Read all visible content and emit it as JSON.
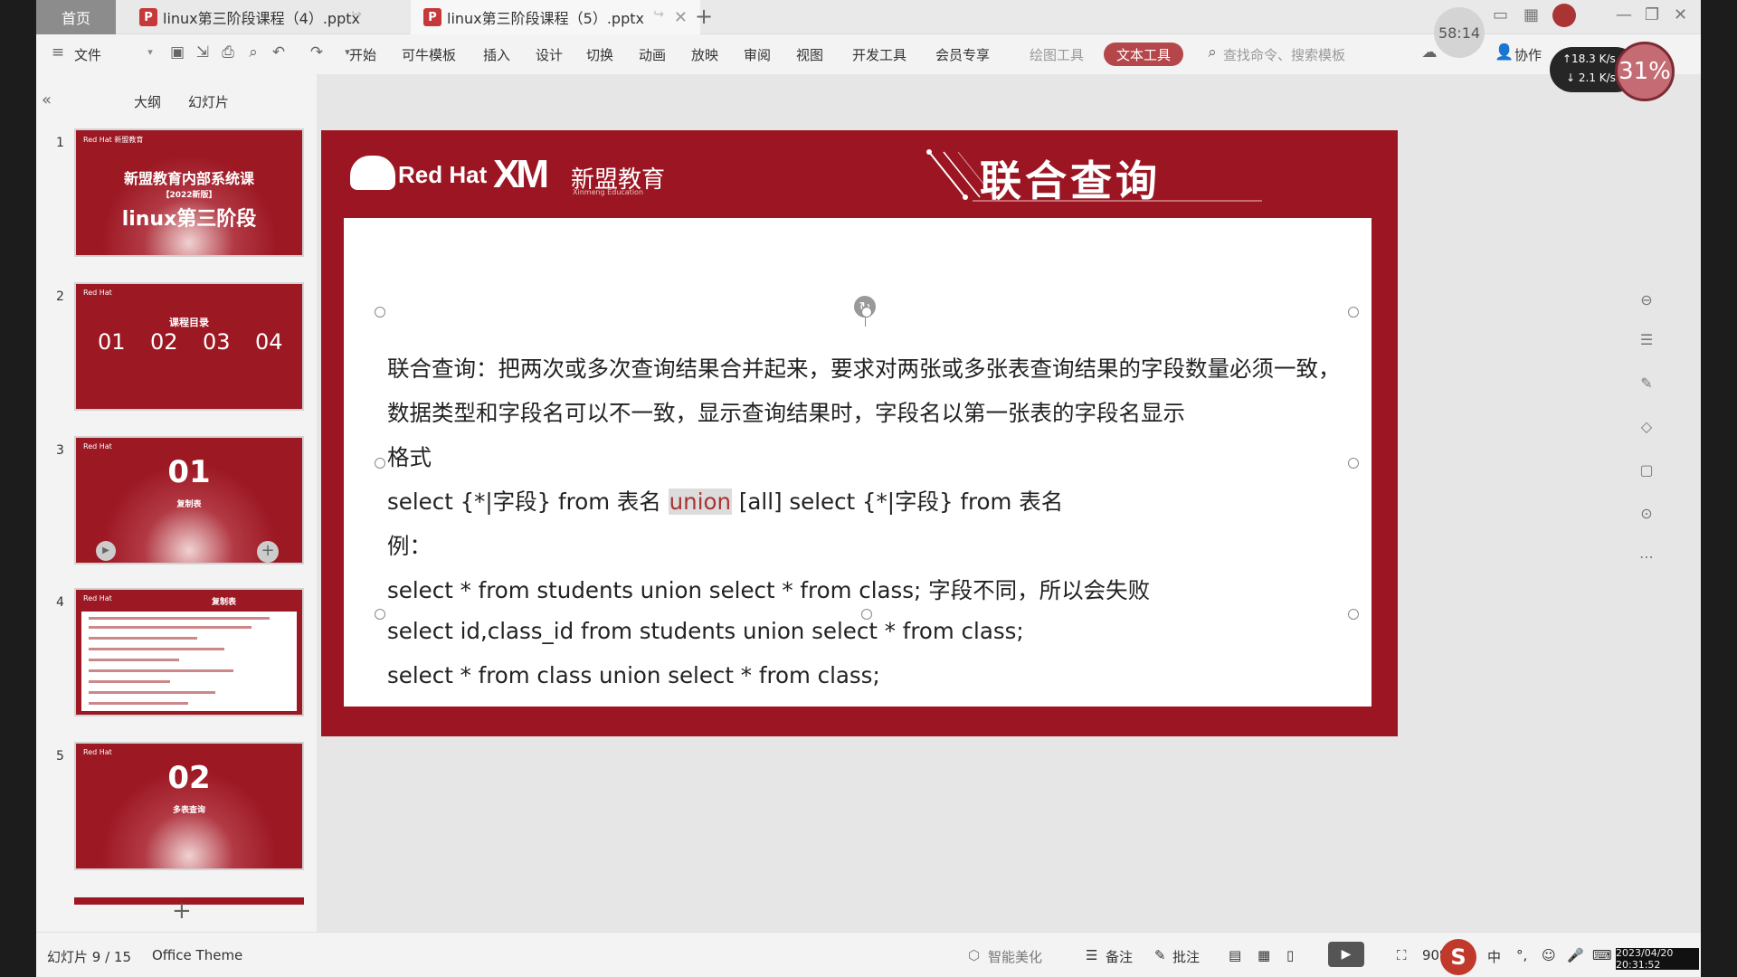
{
  "titlebar": {
    "home_tab": "首页",
    "tabs": [
      {
        "badge": "P",
        "label": "linux第三阶段课程（4）.pptx"
      },
      {
        "badge": "P",
        "label": "linux第三阶段课程（5）.pptx"
      }
    ],
    "timer": "58:14"
  },
  "ribbon": {
    "file": "文件",
    "menus": [
      "开始",
      "可牛模板",
      "插入",
      "设计",
      "切换",
      "动画",
      "放映",
      "审阅",
      "视图",
      "开发工具",
      "会员专享"
    ],
    "drawing_tool": "绘图工具",
    "text_tool": "文本工具",
    "search_placeholder": "查找命令、搜索模板",
    "collab": "协作"
  },
  "netspeed": {
    "up": "↑18.3 K/s",
    "down": "↓ 2.1 K/s",
    "cpu": "31%"
  },
  "left_panel": {
    "tab_outline": "大纲",
    "tab_slides": "幻灯片",
    "thumbnails": [
      {
        "num": "1",
        "logo": "Red Hat  新盟教育",
        "title": "新盟教育内部系统课",
        "sub": "【2022新版】",
        "main": "linux第三阶段"
      },
      {
        "num": "2",
        "logo": "Red Hat",
        "title": "课程目录",
        "items": [
          "01",
          "02",
          "03",
          "04"
        ]
      },
      {
        "num": "3",
        "logo": "Red Hat",
        "big": "01",
        "sub": "复制表"
      },
      {
        "num": "4",
        "logo": "Red Hat",
        "heading": "复制表"
      },
      {
        "num": "5",
        "logo": "Red Hat",
        "big": "02",
        "sub": "多表查询"
      }
    ]
  },
  "slide": {
    "brand_redhat": "Red Hat",
    "brand_xm": "XM",
    "brand_name": "新盟教育",
    "brand_sub": "Xinmeng Education",
    "title": "联合查询",
    "lines": [
      "联合查询：把两次或多次查询结果合并起来，要求对两张或多张表查询结果的字段数量必须一致，",
      "数据类型和字段名可以不一致，显示查询结果时，字段名以第一张表的字段名显示",
      "格式",
      "例：",
      "select * from students union select * from class;    字段不同，所以会失败",
      "select id,class_id from students union select * from class;",
      "select * from class union select * from class;"
    ],
    "format_line": {
      "before": "select {*|字段} from 表名 ",
      "highlight": "union",
      "after": " [all] select {*|字段} from 表名"
    }
  },
  "statusbar": {
    "slide_info": "幻灯片 9 / 15",
    "theme": "Office Theme",
    "beautify": "智能美化",
    "notes": "备注",
    "comments": "批注",
    "zoom": "90%",
    "ime": "中",
    "datetime": "2023/04/20 20:31:52"
  },
  "colors": {
    "slide_red": "#9b1622",
    "accent": "#b5474b"
  }
}
